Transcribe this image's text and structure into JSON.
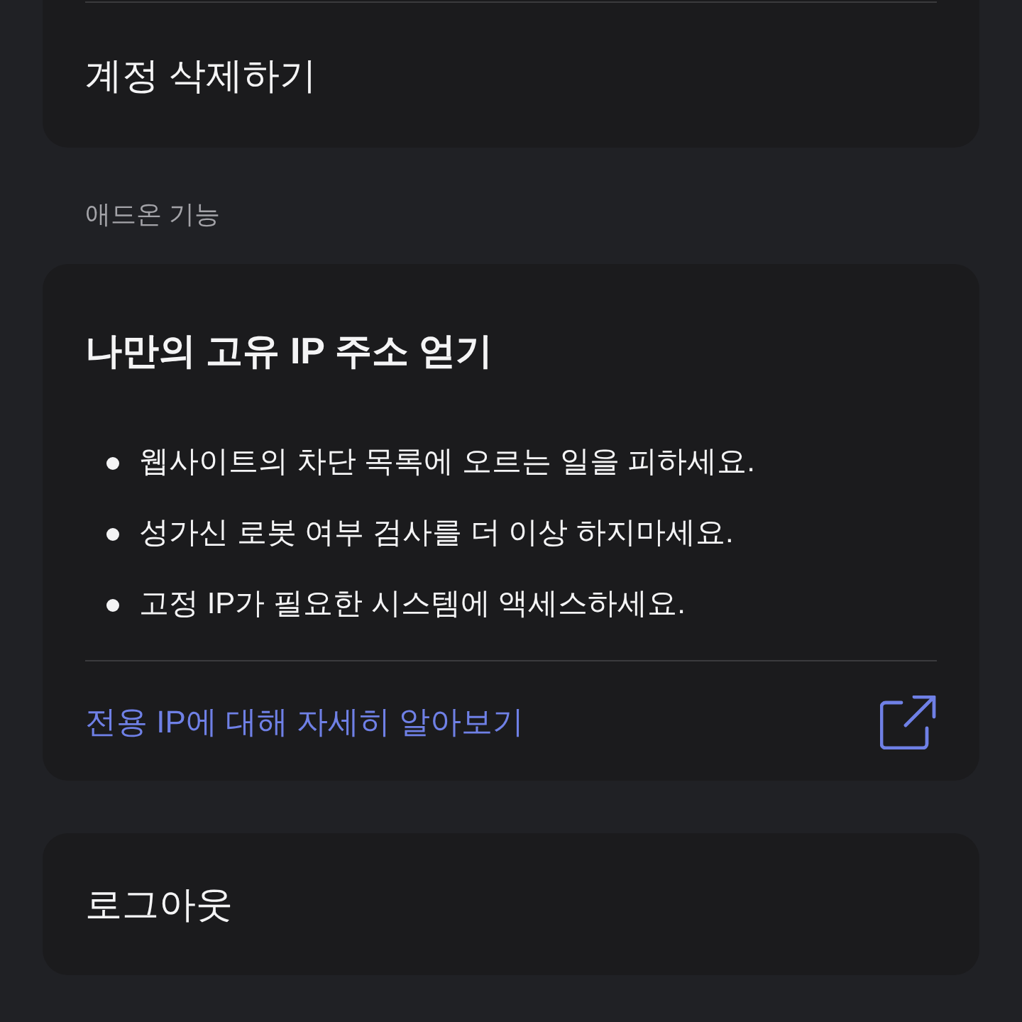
{
  "account_card": {
    "items": [
      {
        "label": "계정 삭제하기"
      }
    ]
  },
  "addons_section": {
    "heading": "애드온 기능",
    "card": {
      "title": "나만의 고유 IP 주소 얻기",
      "bullets": [
        "웹사이트의 차단 목록에 오르는 일을 피하세요.",
        "성가신 로봇 여부 검사를 더 이상 하지마세요.",
        "고정 IP가 필요한 시스템에 액세스하세요."
      ],
      "link": {
        "label": "전용 IP에 대해 자세히 알아보기"
      }
    }
  },
  "logout_card": {
    "label": "로그아웃"
  }
}
